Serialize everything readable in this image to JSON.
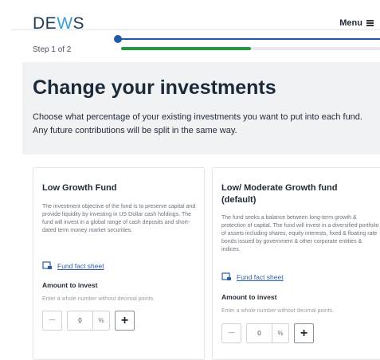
{
  "header": {
    "logo": {
      "prefix": "DE",
      "highlight": "W",
      "suffix": "S"
    },
    "menu_label": "Menu",
    "step_text": "Step 1 of 2",
    "progress": 0.5
  },
  "hero": {
    "title": "Change your investments",
    "subtitle": "Choose what percentage of your existing investments you want to put into each fund. Any future contributions will be split in the same way."
  },
  "funds": [
    {
      "title": "Low Growth Fund",
      "description": "The investment objective of the fund is to preserve capital and provide liquidity by investing in US Dollar cash holdings. The fund will invest in a global range of cash deposits and short-dated term money market securities.",
      "fact_sheet_label": "Fund fact sheet",
      "amount_label": "Amount to invest",
      "amount_hint": "Enter a whole number without decimal points.",
      "value": "0",
      "unit": "%"
    },
    {
      "title": "Low/ Moderate Growth fund (default)",
      "description": "The fund seeks a balance between long-term growth & protection of capital. The fund will invest in a diversified portfolio of assets including shares, equity interests, fixed & floating rate bonds issued by government & other corporate entities & indices.",
      "fact_sheet_label": "Fund fact sheet",
      "amount_label": "Amount to invest",
      "amount_hint": "Enter a whole number without decimal points.",
      "value": "0",
      "unit": "%"
    }
  ],
  "colors": {
    "brand": "#1f3b57",
    "logo_accent": "#3aa0d8",
    "progress": "#219a46",
    "link": "#2a5fa8",
    "slider": "#1f5aa8"
  }
}
